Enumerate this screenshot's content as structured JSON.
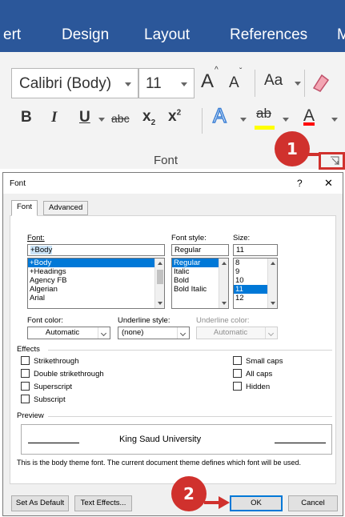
{
  "ribbon": {
    "tabs": [
      "ert",
      "Design",
      "Layout",
      "References",
      "M"
    ],
    "font_name": "Calibri (Body)",
    "font_size": "11",
    "grow_label": "A",
    "shrink_label": "A",
    "case_label": "Aa",
    "bold": "B",
    "italic": "I",
    "underline": "U",
    "strike": "abc",
    "subscript": "x",
    "subscript_sub": "2",
    "superscript": "x",
    "superscript_sup": "2",
    "text_effects": "A",
    "highlight": "ab",
    "font_color": "A",
    "group_label": "Font"
  },
  "dialog": {
    "title": "Font",
    "help": "?",
    "close": "✕",
    "tabs": [
      "Font",
      "Advanced"
    ],
    "font_label": "Font:",
    "font_value": "+Body",
    "font_list": [
      "+Body",
      "+Headings",
      "Agency FB",
      "Algerian",
      "Arial"
    ],
    "style_label": "Font style:",
    "style_value": "Regular",
    "style_list": [
      "Regular",
      "Italic",
      "Bold",
      "Bold Italic"
    ],
    "size_label": "Size:",
    "size_value": "11",
    "size_list": [
      "8",
      "9",
      "10",
      "11",
      "12"
    ],
    "font_color_label": "Font color:",
    "font_color_value": "Automatic",
    "underline_style_label": "Underline style:",
    "underline_style_value": "(none)",
    "underline_color_label": "Underline color:",
    "underline_color_value": "Automatic",
    "effects_label": "Effects",
    "effects_left": [
      "Strikethrough",
      "Double strikethrough",
      "Superscript",
      "Subscript"
    ],
    "effects_right": [
      "Small caps",
      "All caps",
      "Hidden"
    ],
    "preview_label": "Preview",
    "preview_text": "King Saud University",
    "preview_note": "This is the body theme font. The current document theme defines which font will be used.",
    "buttons": {
      "set_default": "Set As Default",
      "text_effects": "Text Effects...",
      "ok": "OK",
      "cancel": "Cancel"
    }
  },
  "callouts": [
    "1",
    "2"
  ],
  "colors": {
    "ribbon_blue": "#2b579a",
    "callout_red": "#d0312d",
    "selection_blue": "#0078d7"
  }
}
